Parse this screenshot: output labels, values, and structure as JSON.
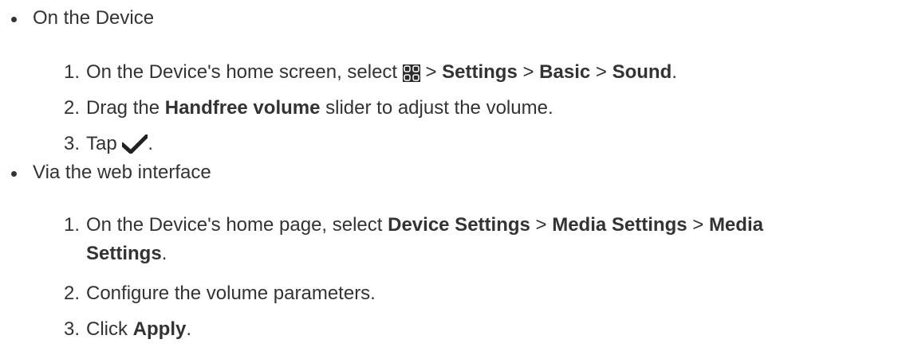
{
  "sections": [
    {
      "title": "On the Device",
      "steps": [
        {
          "number": "1.",
          "parts": {
            "t0": "On the Device's home screen, select",
            "sep1": ">",
            "b1": "Settings",
            "sep2": ">",
            "b2": "Basic",
            "sep3": ">",
            "b3": "Sound",
            "t_end": "."
          },
          "icons": [
            "grid-menu-icon"
          ]
        },
        {
          "number": "2.",
          "parts": {
            "t0": "Drag the",
            "b1": "Handfree volume",
            "t1": "slider to adjust the volume."
          }
        },
        {
          "number": "3.",
          "parts": {
            "t0": "Tap",
            "t_end": "."
          },
          "icons": [
            "checkmark-icon"
          ]
        }
      ]
    },
    {
      "title": "Via the web interface",
      "steps": [
        {
          "number": "1.",
          "parts": {
            "t0": "On the Device's home page, select",
            "b1": "Device Settings",
            "sep1": ">",
            "b2": "Media Settings",
            "sep2": ">",
            "b3": "Media",
            "b4": "Settings",
            "t_end": "."
          }
        },
        {
          "number": "2.",
          "parts": {
            "t0": "Configure the volume parameters."
          }
        },
        {
          "number": "3.",
          "parts": {
            "t0": "Click",
            "b1": "Apply",
            "t_end": "."
          }
        }
      ]
    }
  ]
}
